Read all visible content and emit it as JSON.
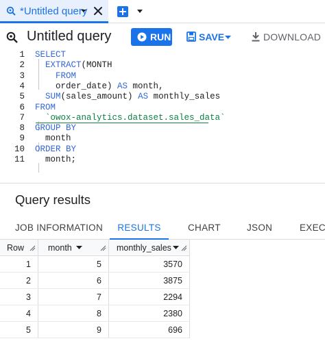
{
  "tab": {
    "label": "*Untitled query"
  },
  "header": {
    "title": "Untitled query",
    "run_label": "RUN",
    "save_label": "SAVE",
    "download_label": "DOWNLOAD"
  },
  "editor": {
    "lines": [
      {
        "n": "1",
        "code": [
          {
            "t": "SELECT",
            "c": "kw"
          }
        ]
      },
      {
        "n": "2",
        "code": [
          {
            "t": "  ",
            "c": "txt"
          },
          {
            "t": "EXTRACT",
            "c": "kw"
          },
          {
            "t": "(MONTH",
            "c": "txt"
          }
        ]
      },
      {
        "n": "3",
        "code": [
          {
            "t": "  ",
            "c": "txt"
          },
          {
            "t": "  FROM",
            "c": "kw"
          }
        ]
      },
      {
        "n": "4",
        "code": [
          {
            "t": "    order_date) ",
            "c": "txt"
          },
          {
            "t": "AS",
            "c": "kw"
          },
          {
            "t": " month,",
            "c": "txt"
          }
        ]
      },
      {
        "n": "5",
        "code": [
          {
            "t": "  ",
            "c": "txt"
          },
          {
            "t": "SUM",
            "c": "kw"
          },
          {
            "t": "(sales_amount) ",
            "c": "txt"
          },
          {
            "t": "AS",
            "c": "kw"
          },
          {
            "t": " monthly_sales",
            "c": "txt"
          }
        ]
      },
      {
        "n": "6",
        "code": [
          {
            "t": "FROM",
            "c": "kw"
          }
        ]
      },
      {
        "n": "7",
        "code": [
          {
            "t": "  `owox-analytics.dataset.sales_data`",
            "c": "str"
          }
        ]
      },
      {
        "n": "8",
        "code": [
          {
            "t": "GROUP BY",
            "c": "kw"
          }
        ]
      },
      {
        "n": "9",
        "code": [
          {
            "t": "  month",
            "c": "txt"
          }
        ]
      },
      {
        "n": "10",
        "code": [
          {
            "t": "ORDER BY",
            "c": "kw"
          }
        ]
      },
      {
        "n": "11",
        "code": [
          {
            "t": "  month;",
            "c": "txt"
          }
        ]
      }
    ]
  },
  "results": {
    "title": "Query results",
    "tabs": [
      "JOB INFORMATION",
      "RESULTS",
      "CHART",
      "JSON",
      "EXECU"
    ],
    "active_tab": "RESULTS",
    "columns": [
      "Row",
      "month",
      "monthly_sales"
    ],
    "rows": [
      [
        "1",
        "5",
        "3570"
      ],
      [
        "2",
        "6",
        "3875"
      ],
      [
        "3",
        "7",
        "2294"
      ],
      [
        "4",
        "8",
        "2380"
      ],
      [
        "5",
        "9",
        "696"
      ]
    ]
  },
  "colors": {
    "accent": "#1a73e8",
    "keyword": "#3367d6",
    "string": "#0b8043",
    "tab_bg": "#e8f0fe"
  },
  "icons": [
    "search-query-icon",
    "caret-down-icon",
    "close-icon",
    "add-tab-icon",
    "query-icon",
    "play-icon",
    "save-disk-icon",
    "download-icon",
    "column-resize-icon"
  ]
}
